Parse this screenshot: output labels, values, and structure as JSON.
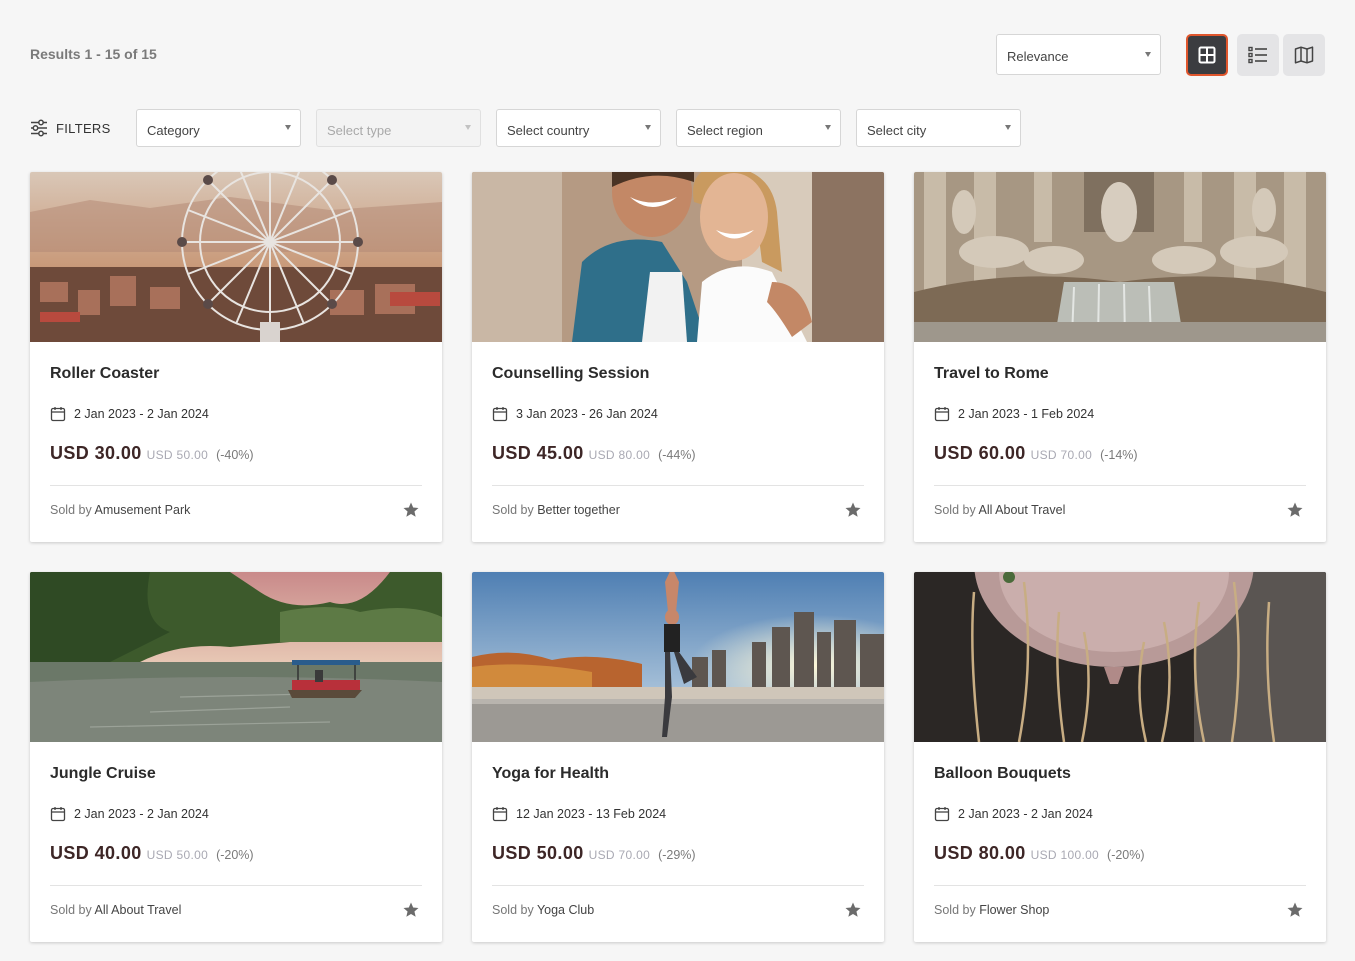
{
  "results_text": "Results 1 - 15 of 15",
  "sort": {
    "selected": "Relevance"
  },
  "view_buttons": [
    {
      "name": "grid-view",
      "icon": "grid-icon",
      "active": true
    },
    {
      "name": "list-view",
      "icon": "list-icon",
      "active": false
    },
    {
      "name": "map-view",
      "icon": "map-icon",
      "active": false
    }
  ],
  "filters": {
    "label": "FILTERS",
    "icon": "sliders-icon",
    "selects": [
      {
        "name": "category",
        "value": "Category",
        "disabled": false
      },
      {
        "name": "type",
        "value": "Select type",
        "disabled": true
      },
      {
        "name": "country",
        "value": "Select country",
        "disabled": false
      },
      {
        "name": "region",
        "value": "Select region",
        "disabled": false
      },
      {
        "name": "city",
        "value": "Select city",
        "disabled": false
      }
    ]
  },
  "sold_by_label": "Sold by",
  "colors": {
    "accent": "#e0562d",
    "price": "#3d2626",
    "active_view_bg": "#3b3c40"
  },
  "cards": [
    {
      "title": "Roller Coaster",
      "dates": "2 Jan 2023 - 2 Jan 2024",
      "price": "USD 30.00",
      "original_price": "USD 50.00",
      "discount": "(-40%)",
      "vendor": "Amusement Park"
    },
    {
      "title": "Counselling Session",
      "dates": "3 Jan 2023 - 26 Jan 2024",
      "price": "USD 45.00",
      "original_price": "USD 80.00",
      "discount": "(-44%)",
      "vendor": "Better together"
    },
    {
      "title": "Travel to Rome",
      "dates": "2 Jan 2023 - 1 Feb 2024",
      "price": "USD 60.00",
      "original_price": "USD 70.00",
      "discount": "(-14%)",
      "vendor": "All About Travel"
    },
    {
      "title": "Jungle Cruise",
      "dates": "2 Jan 2023 - 2 Jan 2024",
      "price": "USD 40.00",
      "original_price": "USD 50.00",
      "discount": "(-20%)",
      "vendor": "All About Travel"
    },
    {
      "title": "Yoga for Health",
      "dates": "12 Jan 2023 - 13 Feb 2024",
      "price": "USD 50.00",
      "original_price": "USD 70.00",
      "discount": "(-29%)",
      "vendor": "Yoga Club"
    },
    {
      "title": "Balloon Bouquets",
      "dates": "2 Jan 2023 - 2 Jan 2024",
      "price": "USD 80.00",
      "original_price": "USD 100.00",
      "discount": "(-20%)",
      "vendor": "Flower Shop"
    }
  ]
}
